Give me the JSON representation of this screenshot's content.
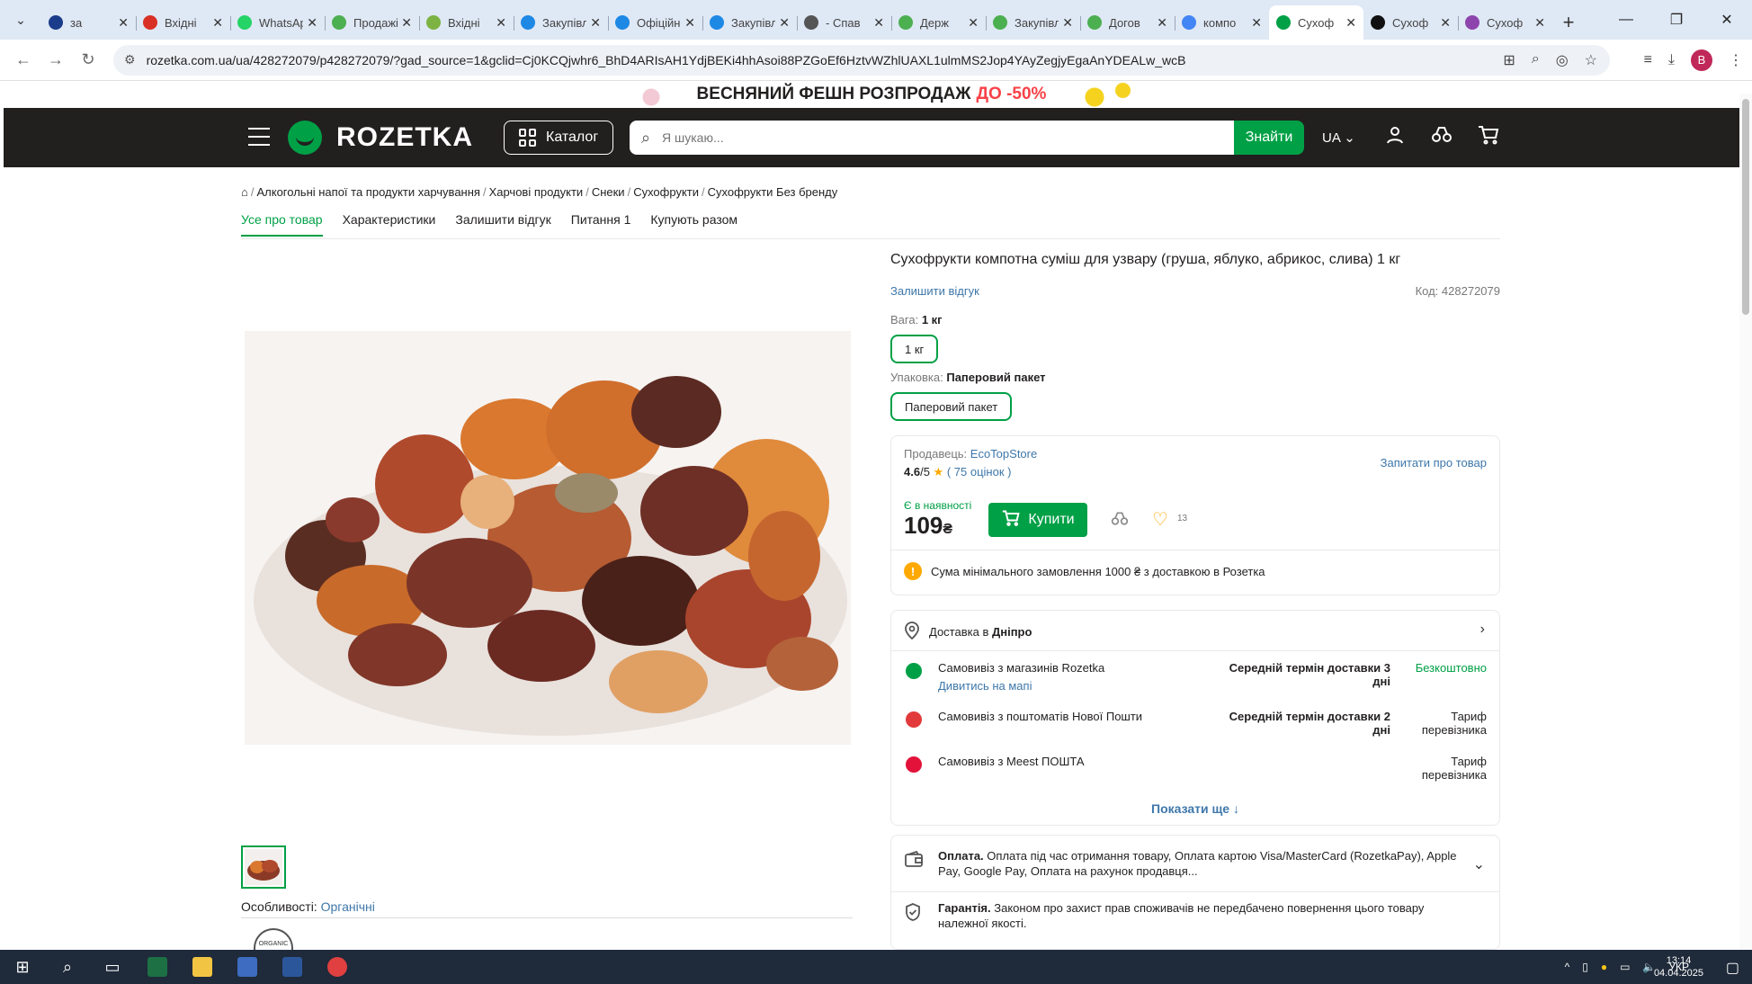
{
  "browser": {
    "tabs": [
      {
        "title": "за",
        "favicon_color": "#1a3c8a"
      },
      {
        "title": "Вхідні",
        "favicon_color": "#d93025"
      },
      {
        "title": "WhatsApp",
        "favicon_color": "#25d366"
      },
      {
        "title": "Продажі",
        "favicon_color": "#4caf50"
      },
      {
        "title": "Вхідні",
        "favicon_color": "#7cb342"
      },
      {
        "title": "Закупівлі",
        "favicon_color": "#1e88e5"
      },
      {
        "title": "Офіційний",
        "favicon_color": "#1e88e5"
      },
      {
        "title": "Закупівлі",
        "favicon_color": "#1e88e5"
      },
      {
        "title": "- Спав",
        "favicon_color": "#555555"
      },
      {
        "title": "Держ",
        "favicon_color": "#4caf50"
      },
      {
        "title": "Закупівлі",
        "favicon_color": "#4caf50"
      },
      {
        "title": "Догов",
        "favicon_color": "#4caf50"
      },
      {
        "title": "компо",
        "favicon_color": "#4285f4"
      },
      {
        "title": "Сухоф",
        "favicon_color": "#00a046",
        "active": true
      },
      {
        "title": "Сухоф",
        "favicon_color": "#111111"
      },
      {
        "title": "Сухоф",
        "favicon_color": "#8e44ad"
      }
    ],
    "url": "rozetka.com.ua/ua/428272079/p428272079/?gad_source=1&gclid=Cj0KCQjwhr6_BhD4ARIsAH1YdjBEKi4hhAsoi88PZGoEf6HztvWZhlUAXL1ulmMS2Jop4YAyZegjyEgaAnYDEALw_wcB",
    "profile_letter": "B"
  },
  "promo": {
    "text": "ВЕСНЯНИЙ ФЕШН РОЗПРОДАЖ",
    "discount": "ДО -50%"
  },
  "header": {
    "logo": "ROZETKA",
    "catalog_label": "Каталог",
    "search_placeholder": "Я шукаю...",
    "search_button": "Знайти",
    "language": "UA"
  },
  "breadcrumbs": [
    "Алкогольні напої та продукти харчування",
    "Харчові продукти",
    "Снеки",
    "Сухофрукти",
    "Сухофрукти Без бренду"
  ],
  "product_tabs": [
    "Усе про товар",
    "Характеристики",
    "Залишити відгук",
    "Питання 1",
    "Купують разом"
  ],
  "product": {
    "title": "Сухофрукти компотна суміш для узвару (груша, яблуко, абрикос, слива) 1 кг",
    "review_link": "Залишити відгук",
    "code_label": "Код:",
    "code": "428272079",
    "weight_label": "Вага:",
    "weight_value": "1 кг",
    "weight_chip": "1 кг",
    "pack_label": "Упаковка:",
    "pack_value": "Паперовий пакет",
    "pack_chip": "Паперовий пакет",
    "features_label": "Особливості:",
    "features_value": "Органічні",
    "organic_badge": "ORGANIC"
  },
  "seller": {
    "label": "Продавець:",
    "name": "EcoTopStore",
    "rating": "4.6",
    "rating_max": "/5",
    "reviews": "75 оцінок",
    "ask": "Запитати про товар"
  },
  "purchase": {
    "availability": "Є в наявності",
    "price": "109",
    "currency": "₴",
    "buy": "Купити",
    "likes": "13",
    "min_order": "Сума мінімального замовлення 1000 ₴ з доставкою в Розетка"
  },
  "delivery": {
    "label": "Доставка в",
    "city": "Дніпро",
    "options": [
      {
        "name": "Самовивіз з магазинів Rozetka",
        "link": "Дивитись на мапі",
        "term": "Середній термін доставки 3 дні",
        "cost": "Безкоштовно",
        "icon_color": "#00a046"
      },
      {
        "name": "Самовивіз з поштоматів Нової Пошти",
        "link": "",
        "term": "Середній термін доставки 2 дні",
        "cost": "Тариф перевізника",
        "icon_color": "#e23a3a"
      },
      {
        "name": "Самовивіз з Meest ПОШТА",
        "link": "",
        "term": "",
        "cost": "Тариф перевізника",
        "icon_color": "#e2123a"
      }
    ],
    "show_more": "Показати ще"
  },
  "payment": {
    "title": "Оплата.",
    "text": "Оплата під час отримання товару, Оплата картою Visa/MasterCard (RozetkaPay), Apple Pay, Google Pay, Оплата на рахунок продавця..."
  },
  "guarantee": {
    "title": "Гарантія.",
    "text": "Законом про захист прав споживачів не передбачено повернення цього товару належної якості."
  },
  "taskbar": {
    "lang": "УКР",
    "time": "13:14",
    "date": "04.04.2025"
  }
}
